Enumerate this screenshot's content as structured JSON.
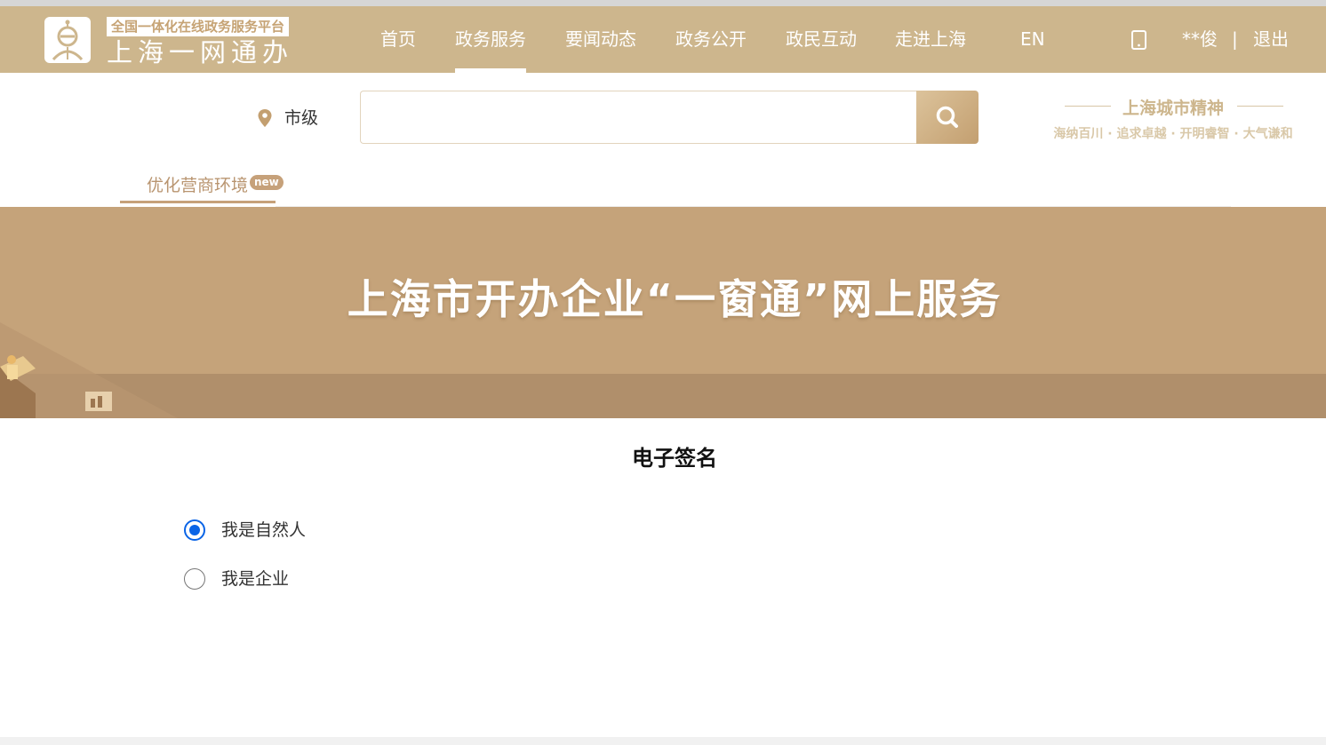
{
  "header": {
    "logo": {
      "subtitle": "全国一体化在线政务服务平台",
      "title": "上海一网通办"
    },
    "nav": [
      {
        "label": "首页"
      },
      {
        "label": "政务服务",
        "active": true
      },
      {
        "label": "要闻动态"
      },
      {
        "label": "政务公开"
      },
      {
        "label": "政民互动"
      },
      {
        "label": "走进上海"
      },
      {
        "label": "EN"
      }
    ],
    "mobile_icon": "mobile-phone-icon",
    "user_name": "**俊",
    "separator": "|",
    "logout_label": "退出"
  },
  "search": {
    "location_icon": "map-pin-icon",
    "location_label": "市级",
    "value": "",
    "placeholder": "",
    "button_icon": "search-icon"
  },
  "city_spirit": {
    "title": "上海城市精神",
    "slogan": "海纳百川 · 追求卓越 · 开明睿智 · 大气谦和"
  },
  "tabs": [
    {
      "label": "优化营商环境",
      "badge": "new",
      "active": true
    }
  ],
  "banner": {
    "title": "上海市开办企业“一窗通”网上服务"
  },
  "main": {
    "section_title": "电子签名",
    "options": [
      {
        "label": "我是自然人",
        "checked": true
      },
      {
        "label": "我是企业",
        "checked": false
      }
    ]
  },
  "colors": {
    "header_bg": "#cdb68d",
    "banner_bg": "#c5a37a",
    "accent_gold": "#c6a17a",
    "radio_blue": "#0a64e6"
  }
}
